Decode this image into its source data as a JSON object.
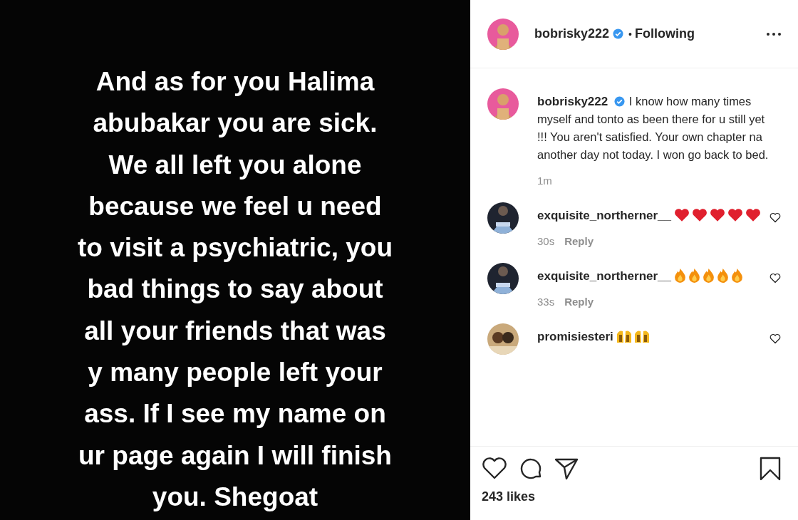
{
  "post_image": {
    "lines": [
      "And as for you Halima",
      "abubakar you are sick.",
      "We all left you alone",
      "because we feel u need",
      "to visit a psychiatric, you",
      "bad things to say about",
      "all your friends that was",
      "y many people left your",
      "ass. If I see my name on",
      "ur page again I will finish",
      "you. Shegoat"
    ]
  },
  "header": {
    "username": "bobrisky222",
    "verified": true,
    "separator": "•",
    "follow_status": "Following"
  },
  "caption": {
    "username": "bobrisky222",
    "verified": true,
    "text": "I know how many times myself and tonto as been there for u still yet !!! You aren't satisfied. Your own chapter na another day not today. I won go back to bed.",
    "time": "1m"
  },
  "comments": [
    {
      "username": "exquisite_northerner__",
      "emojis": [
        {
          "kind": "heart"
        },
        {
          "kind": "heart"
        },
        {
          "kind": "heart"
        },
        {
          "kind": "heart"
        },
        {
          "kind": "heart"
        }
      ],
      "time": "30s",
      "reply": "Reply"
    },
    {
      "username": "exquisite_northerner__",
      "emojis": [
        {
          "kind": "fire"
        },
        {
          "kind": "fire"
        },
        {
          "kind": "fire"
        },
        {
          "kind": "fire"
        },
        {
          "kind": "fire"
        }
      ],
      "time": "33s",
      "reply": "Reply"
    },
    {
      "username": "promisiesteri",
      "emojis": [
        {
          "kind": "hands"
        },
        {
          "kind": "hands"
        }
      ]
    }
  ],
  "likes": "243 likes"
}
